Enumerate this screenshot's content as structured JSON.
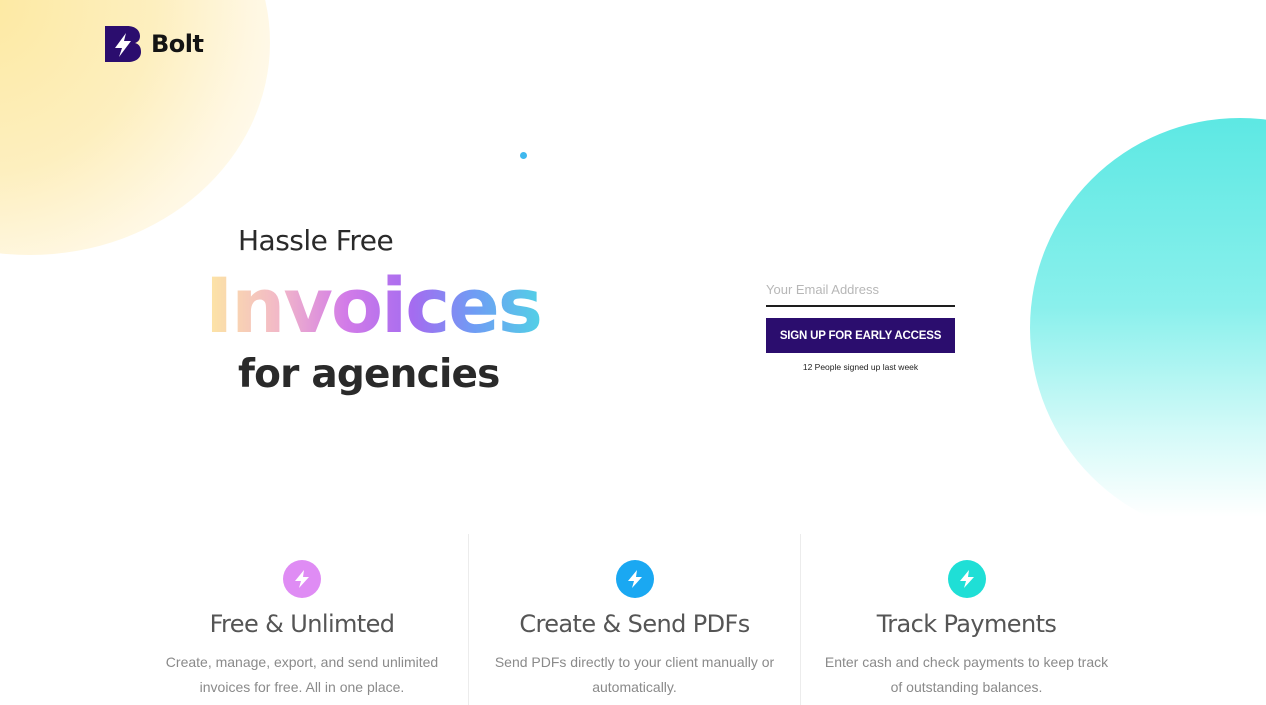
{
  "brand": {
    "name": "Bolt",
    "logo_icon": "bolt-b-logo-icon",
    "color": "#2b0d6e"
  },
  "hero": {
    "line1": "Hassle Free",
    "line2": "Invoices",
    "line3": "for agencies"
  },
  "signup": {
    "email_placeholder": "Your Email Address",
    "button_label": "SIGN UP FOR EARLY ACCESS",
    "note": "12 People signed up last week"
  },
  "features": [
    {
      "icon": "lightning-icon",
      "icon_color": "#df8cf4",
      "title": "Free & Unlimted",
      "desc": "Create, manage, export, and send unlimited invoices for free. All in one place."
    },
    {
      "icon": "lightning-icon",
      "icon_color": "#1aa8f2",
      "title": "Create & Send PDFs",
      "desc": "Send PDFs directly to your client manually or automatically."
    },
    {
      "icon": "lightning-icon",
      "icon_color": "#1fdfd6",
      "title": "Track Payments",
      "desc": "Enter cash and check payments to keep track of outstanding balances."
    }
  ]
}
